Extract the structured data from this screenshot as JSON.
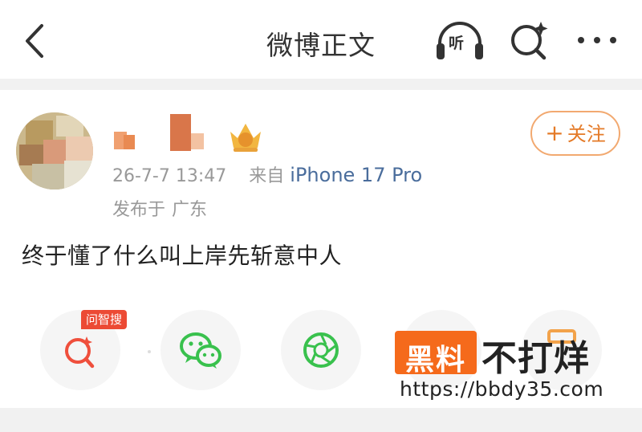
{
  "nav": {
    "title": "微博正文",
    "listen_glyph": "听",
    "icons": [
      "back-icon",
      "listen-icon",
      "search-icon",
      "more-icon"
    ]
  },
  "post": {
    "timestamp": "26-7-7 13:47",
    "source_prefix": "来自",
    "source": "iPhone 17 Pro",
    "location_prefix": "发布于",
    "location": "广东",
    "follow_label": "关注",
    "follow_plus": "+",
    "text": "终于懂了什么叫上岸先斩意中人"
  },
  "share": {
    "tag": "问智搜",
    "items": [
      "ai-search-icon",
      "wechat-icon",
      "moments-icon",
      "qq-icon",
      "link-icon"
    ]
  },
  "watermark": {
    "box_text": "黑料",
    "title": "不打烊",
    "url": "https://bbdy35.com"
  },
  "colors": {
    "accent": "#e47a27",
    "follow_border": "#f2a970",
    "source_link": "#4a6d9c",
    "meta_text": "#999999",
    "tag_bg": "#ec4a34",
    "wechat_green": "#39c14d",
    "search_red": "#ef4f3c",
    "watermark_orange": "#f56a1b"
  }
}
